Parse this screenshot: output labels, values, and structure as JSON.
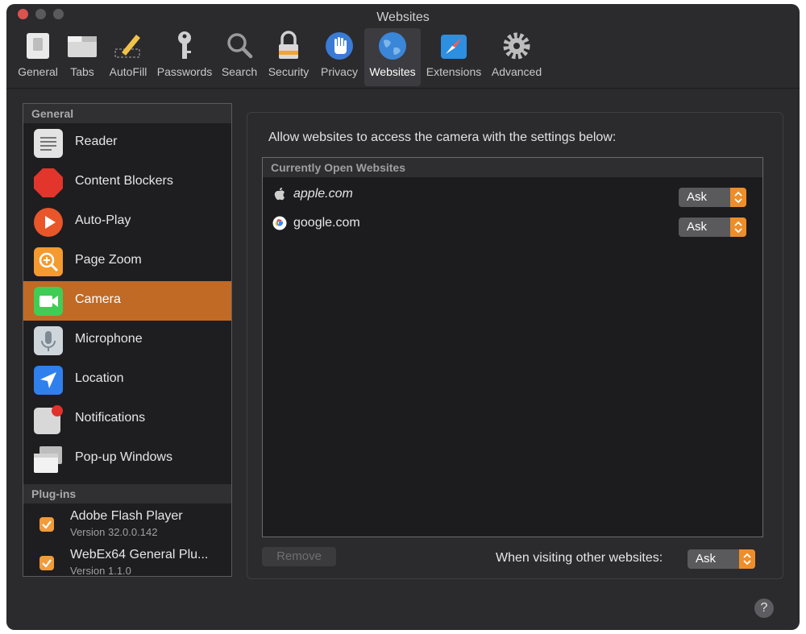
{
  "window": {
    "title": "Websites"
  },
  "toolbar": {
    "tabs": [
      {
        "label": "General",
        "icon": "general-switch-icon"
      },
      {
        "label": "Tabs",
        "icon": "tabs-icon"
      },
      {
        "label": "AutoFill",
        "icon": "autofill-pencil-icon"
      },
      {
        "label": "Passwords",
        "icon": "key-icon"
      },
      {
        "label": "Search",
        "icon": "magnifier-icon"
      },
      {
        "label": "Security",
        "icon": "padlock-icon"
      },
      {
        "label": "Privacy",
        "icon": "hand-icon"
      },
      {
        "label": "Websites",
        "icon": "globe-icon"
      },
      {
        "label": "Extensions",
        "icon": "puzzle-compass-icon"
      },
      {
        "label": "Advanced",
        "icon": "gear-icon"
      }
    ],
    "active": "Websites"
  },
  "sidebar": {
    "general_header": "General",
    "items": [
      {
        "label": "Reader",
        "icon": "reader-icon"
      },
      {
        "label": "Content Blockers",
        "icon": "stop-sign-icon"
      },
      {
        "label": "Auto-Play",
        "icon": "play-icon"
      },
      {
        "label": "Page Zoom",
        "icon": "zoom-icon"
      },
      {
        "label": "Camera",
        "icon": "camera-icon"
      },
      {
        "label": "Microphone",
        "icon": "microphone-icon"
      },
      {
        "label": "Location",
        "icon": "location-arrow-icon"
      },
      {
        "label": "Notifications",
        "icon": "notifications-icon"
      },
      {
        "label": "Pop-up Windows",
        "icon": "popup-windows-icon"
      }
    ],
    "selected": "Camera",
    "plugins_header": "Plug-ins",
    "plugins": [
      {
        "name": "Adobe Flash Player",
        "version": "Version 32.0.0.142",
        "checked": true
      },
      {
        "name": "WebEx64 General Plu...",
        "version": "Version 1.1.0",
        "checked": true
      }
    ]
  },
  "panel": {
    "description": "Allow websites to access the camera with the settings below:",
    "list_header": "Currently Open Websites",
    "sites": [
      {
        "domain": "apple.com",
        "icon": "apple-logo-icon",
        "setting": "Ask"
      },
      {
        "domain": "google.com",
        "icon": "google-logo-icon",
        "setting": "Ask"
      }
    ],
    "remove_label": "Remove",
    "other_label": "When visiting other websites:",
    "other_setting": "Ask"
  },
  "help_label": "?",
  "colors": {
    "accent": "#c06a26",
    "stepper": "#ee8e2a",
    "background": "#2b2a2d"
  }
}
